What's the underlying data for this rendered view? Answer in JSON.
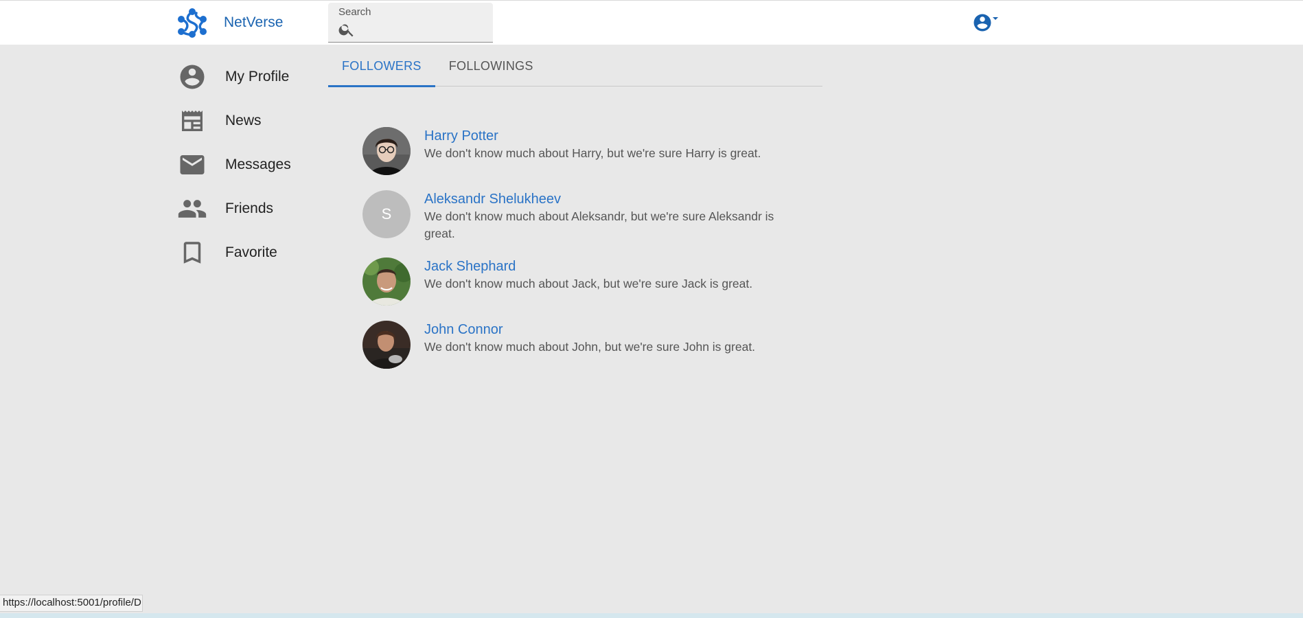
{
  "header": {
    "brand_name": "NetVerse",
    "search": {
      "label": "Search",
      "value": ""
    }
  },
  "sidebar": {
    "items": [
      {
        "label": "My Profile",
        "icon": "account-circle-icon"
      },
      {
        "label": "News",
        "icon": "newspaper-icon"
      },
      {
        "label": "Messages",
        "icon": "mail-icon"
      },
      {
        "label": "Friends",
        "icon": "people-icon"
      },
      {
        "label": "Favorite",
        "icon": "bookmark-icon"
      }
    ]
  },
  "tabs": [
    {
      "label": "FOLLOWERS",
      "active": true
    },
    {
      "label": "FOLLOWINGS",
      "active": false
    }
  ],
  "followers": [
    {
      "name": "Harry Potter",
      "description": "We don't know much about Harry, but we're sure Harry is great.",
      "avatar": "photo"
    },
    {
      "name": "Aleksandr Shelukheev",
      "description": "We don't know much about Aleksandr, but we're sure Aleksandr is great.",
      "avatar_letter": "S"
    },
    {
      "name": "Jack Shephard",
      "description": "We don't know much about Jack, but we're sure Jack is great.",
      "avatar": "photo"
    },
    {
      "name": "John Connor",
      "description": "We don't know much about John, but we're sure John is great.",
      "avatar": "photo"
    }
  ],
  "status_bar": {
    "url": "https://localhost:5001/profile/D"
  },
  "colors": {
    "accent": "#2a73c6",
    "brand": "#1a63b0",
    "background": "#e8e8e8",
    "icon": "#666666"
  }
}
